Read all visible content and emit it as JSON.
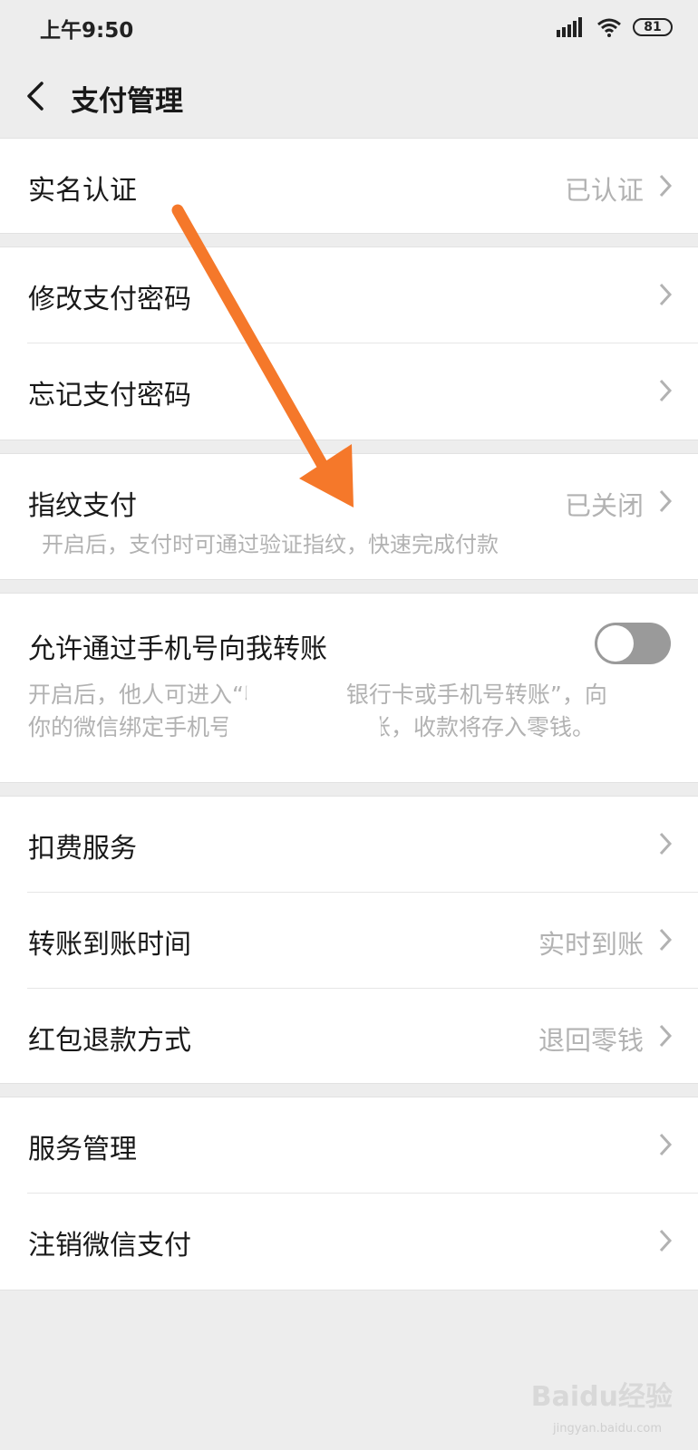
{
  "status": {
    "time": "上午9:50",
    "battery": "81"
  },
  "nav": {
    "title": "支付管理"
  },
  "groups": {
    "g1": {
      "real_name": {
        "label": "实名认证",
        "value": "已认证"
      }
    },
    "g2": {
      "change_pwd": {
        "label": "修改支付密码"
      },
      "forgot_pwd": {
        "label": "忘记支付密码"
      }
    },
    "g3": {
      "fingerprint": {
        "label": "指纹支付",
        "value": "已关闭",
        "desc": "开启后，支付时可通过验证指纹，快速完成付款"
      }
    },
    "g4": {
      "phone_transfer": {
        "label": "允许通过手机号向我转账",
        "toggle_on": false,
        "desc_line1": "开启后，他人可进入“收付款”向银行卡或手机号转账”，向",
        "desc_line2": "你的微信绑定手机号**********转账，收款将存入零钱。"
      }
    },
    "g5": {
      "deduction": {
        "label": "扣费服务"
      },
      "arrival_time": {
        "label": "转账到账时间",
        "value": "实时到账"
      },
      "refund_method": {
        "label": "红包退款方式",
        "value": "退回零钱"
      }
    },
    "g6": {
      "service_mgmt": {
        "label": "服务管理"
      },
      "cancel_pay": {
        "label": "注销微信支付"
      }
    }
  },
  "colors": {
    "arrow": "#f5782a",
    "toggle_off": "#9a9a9a",
    "bg": "#ededed"
  },
  "watermark": {
    "text": "Baidu经验",
    "sub": "jingyan.baidu.com"
  }
}
